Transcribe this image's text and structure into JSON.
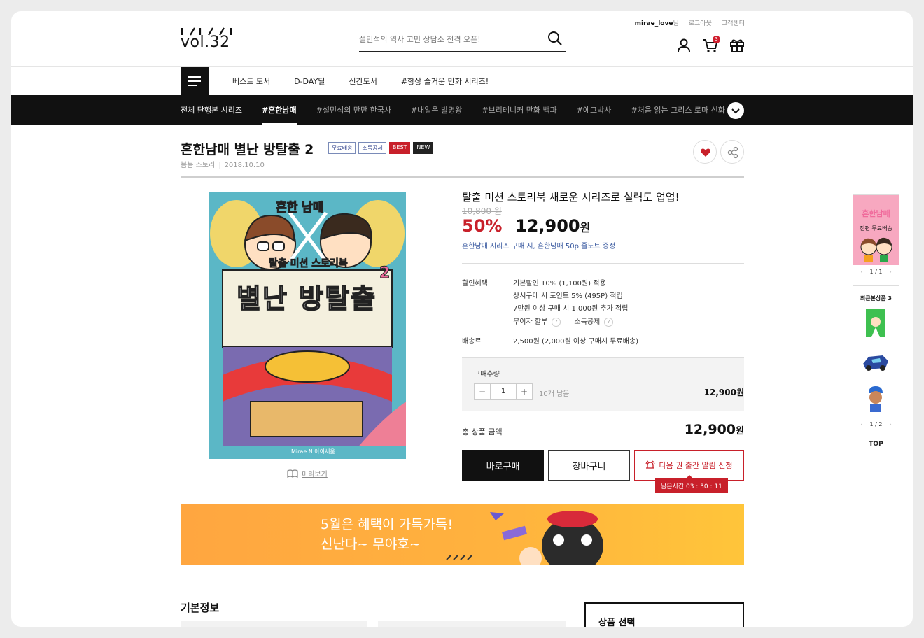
{
  "header": {
    "logo_text": "vol.32",
    "search_placeholder": "설민석의 역사 고민 상담소 전격 오픈!",
    "username": "mirae_love",
    "username_suffix": "님",
    "logout": "로그아웃",
    "support": "고객센터",
    "cart_count": "3"
  },
  "nav": {
    "items": [
      "베스트 도서",
      "D-DAY딜",
      "신간도서",
      "#항상 즐거운 만화 시리즈!"
    ]
  },
  "series_bar": {
    "first": "전체 단행본 시리즈",
    "active": "#흔한남매",
    "items": [
      "#설민석의 만만 한국사",
      "#내일은 발명왕",
      "#브리테니커 만화 백과",
      "#에그박사",
      "#처음 읽는 그리스 로마 신화",
      "#처"
    ]
  },
  "product": {
    "title": "흔한남매 별난 방탈출 2",
    "badges": [
      "무료배송",
      "소득공제",
      "BEST",
      "NEW"
    ],
    "publisher": "봄봄 스토리",
    "date": "2018.10.10",
    "cover": {
      "top_title": "흔한 남매",
      "subtitle": "탈출 미션 스토리북",
      "main_title": "별난 방탈출",
      "number": "2",
      "publisher_mark": "Mirae N 아이세움"
    },
    "preview_label": "미리보기",
    "headline": "탈출 미션 스토리북 새로운 시리즈로 실력도 업업!",
    "original_price": "10,800 원",
    "discount": "50%",
    "price": "12,900",
    "price_unit": "원",
    "promo": "흔한남매 시리즈 구매 시, 흔한남매 50p 줄노트 증정",
    "benefits_label": "할인혜택",
    "benefits": [
      "기본할인 10% (1,100원) 적용",
      "상시구매 시 포인트 5% (495P) 적립",
      "7만원 이상 구매 시 1,000원 추가 적립"
    ],
    "extra1": "무이자 할부",
    "extra2": "소득공제",
    "help_mark": "?",
    "shipping_label": "배송료",
    "shipping_value": "2,500원 (2,000원 이상 구매시 무료배송)",
    "qty_label": "구매수량",
    "qty_minus": "−",
    "qty_value": "1",
    "qty_plus": "+",
    "qty_remaining": "10개 남음",
    "qty_price": "12,900원",
    "total_label": "총 상품 금액",
    "total_value": "12,900",
    "total_unit": "원",
    "buy_now": "바로구매",
    "cart": "장바구니",
    "alert": "다음 권 출간 알림 신청",
    "timer": "남은시간 03 : 30 : 11"
  },
  "banner": {
    "line1": "5월은 혜택이 가득가득!",
    "line2": "신난다~ 무야호~"
  },
  "section": {
    "basic_info": "기본정보",
    "select_product": "상품 선택"
  },
  "rail": {
    "ad_title": "흔한남매",
    "ad_sub": "전편 무료배송",
    "ad_pager": "1 / 1",
    "recent_title": "최근본상품 3",
    "recent_pager": "1 / 2",
    "top": "TOP"
  },
  "colors": {
    "accent_red": "#c8202a",
    "dark": "#111111",
    "link_blue": "#3a5aa0",
    "banner_orange": "#ffa640",
    "cover_teal": "#5bb7c6"
  }
}
